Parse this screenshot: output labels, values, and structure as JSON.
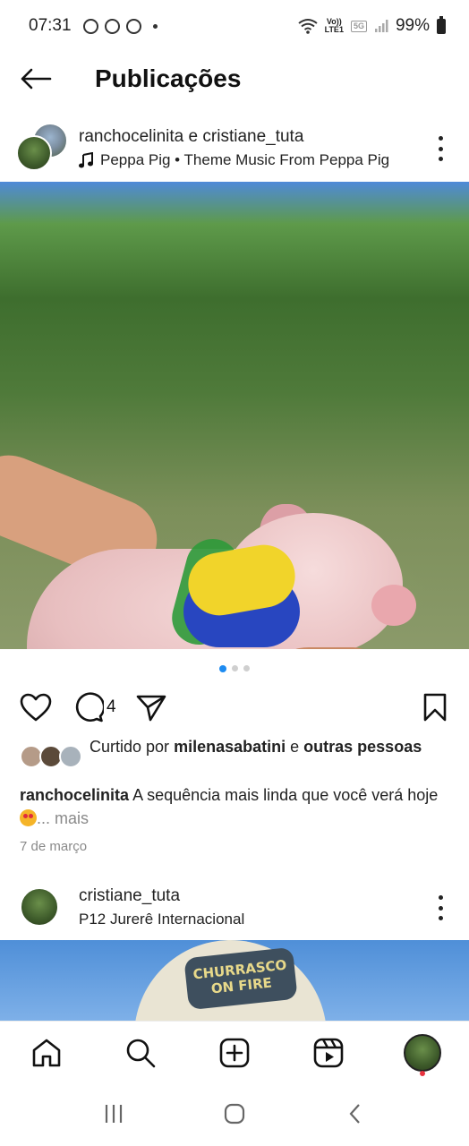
{
  "status_bar": {
    "time": "07:31",
    "network_top": "Vo))",
    "network_bottom": "LTE1",
    "network_type": "5G",
    "battery": "99%"
  },
  "header": {
    "title": "Publicações"
  },
  "post1": {
    "author1": "ranchocelinita",
    "connector": "e",
    "author2": "cristiane_tuta",
    "music": "Peppa Pig • Theme Music From Peppa Pig",
    "comment_count": "4",
    "liked_prefix": "Curtido por",
    "liked_user": "milenasabatini",
    "liked_connector": "e",
    "liked_suffix": "outras pessoas",
    "caption_user": "ranchocelinita",
    "caption_text": "A sequência mais linda que você verá hoje",
    "caption_more": "... mais",
    "date": "7 de março"
  },
  "post2": {
    "author": "cristiane_tuta",
    "location": "P12 Jurerê Internacional",
    "cap_text": "CHURRASCO ON FIRE"
  },
  "icons": {
    "back": "arrow-left-icon",
    "more": "more-vertical-icon",
    "music": "music-note-icon",
    "mute": "volume-off-icon",
    "like": "heart-icon",
    "comment": "comment-icon",
    "share": "send-icon",
    "save": "bookmark-icon",
    "home": "home-icon",
    "search": "search-icon",
    "create": "plus-square-icon",
    "reels": "reels-icon"
  },
  "colors": {
    "accent": "#1d8bf1",
    "notification": "#e8323f"
  }
}
